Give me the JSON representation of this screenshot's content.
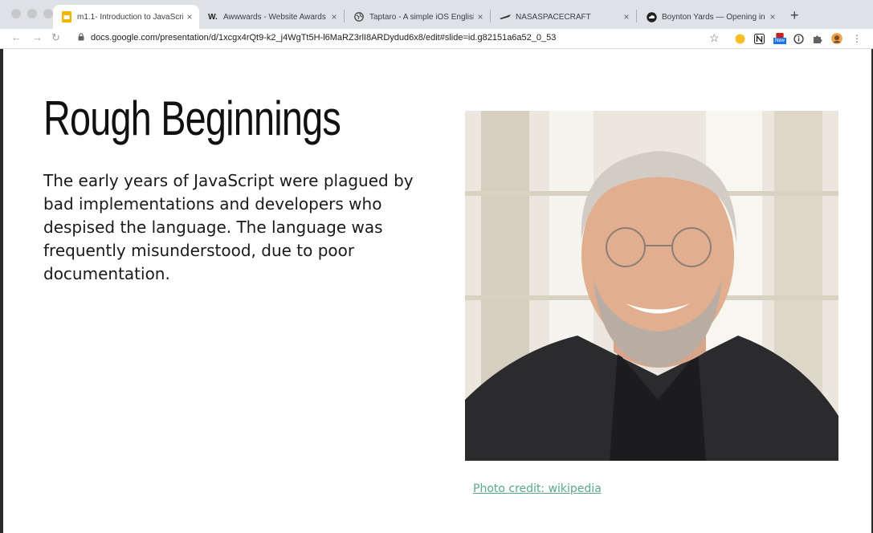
{
  "browser": {
    "tabs": [
      {
        "title": "m1.1- Introduction to JavaScri",
        "favicon": "slides-icon",
        "active": true
      },
      {
        "title": "Awwwards - Website Awards",
        "favicon": "awwwards-icon",
        "active": false
      },
      {
        "title": "Taptaro - A simple iOS English",
        "favicon": "globe-icon",
        "active": false
      },
      {
        "title": "NASASPACECRAFT",
        "favicon": "nasa-icon",
        "active": false
      },
      {
        "title": "Boynton Yards — Opening in E",
        "favicon": "cloud-icon",
        "active": false
      }
    ],
    "new_tab": "+",
    "close_glyph": "×",
    "url": "docs.google.com/presentation/d/1xcgx4rQt9-k2_j4WgTt5H-l6MaRZ3rlI8ARDydud6x8/edit#slide=id.g82151a6a52_0_53",
    "extension_badge": "New"
  },
  "slide": {
    "title": "Rough Beginnings",
    "body": "The early years of JavaScript were plagued by bad implementations and developers who despised the language. The language was frequently misunderstood, due to poor documentation.",
    "photo_credit": "Photo credit: wikipedia"
  },
  "colors": {
    "credit_link": "#5aa88a",
    "slides_favicon": "#f4b400"
  }
}
